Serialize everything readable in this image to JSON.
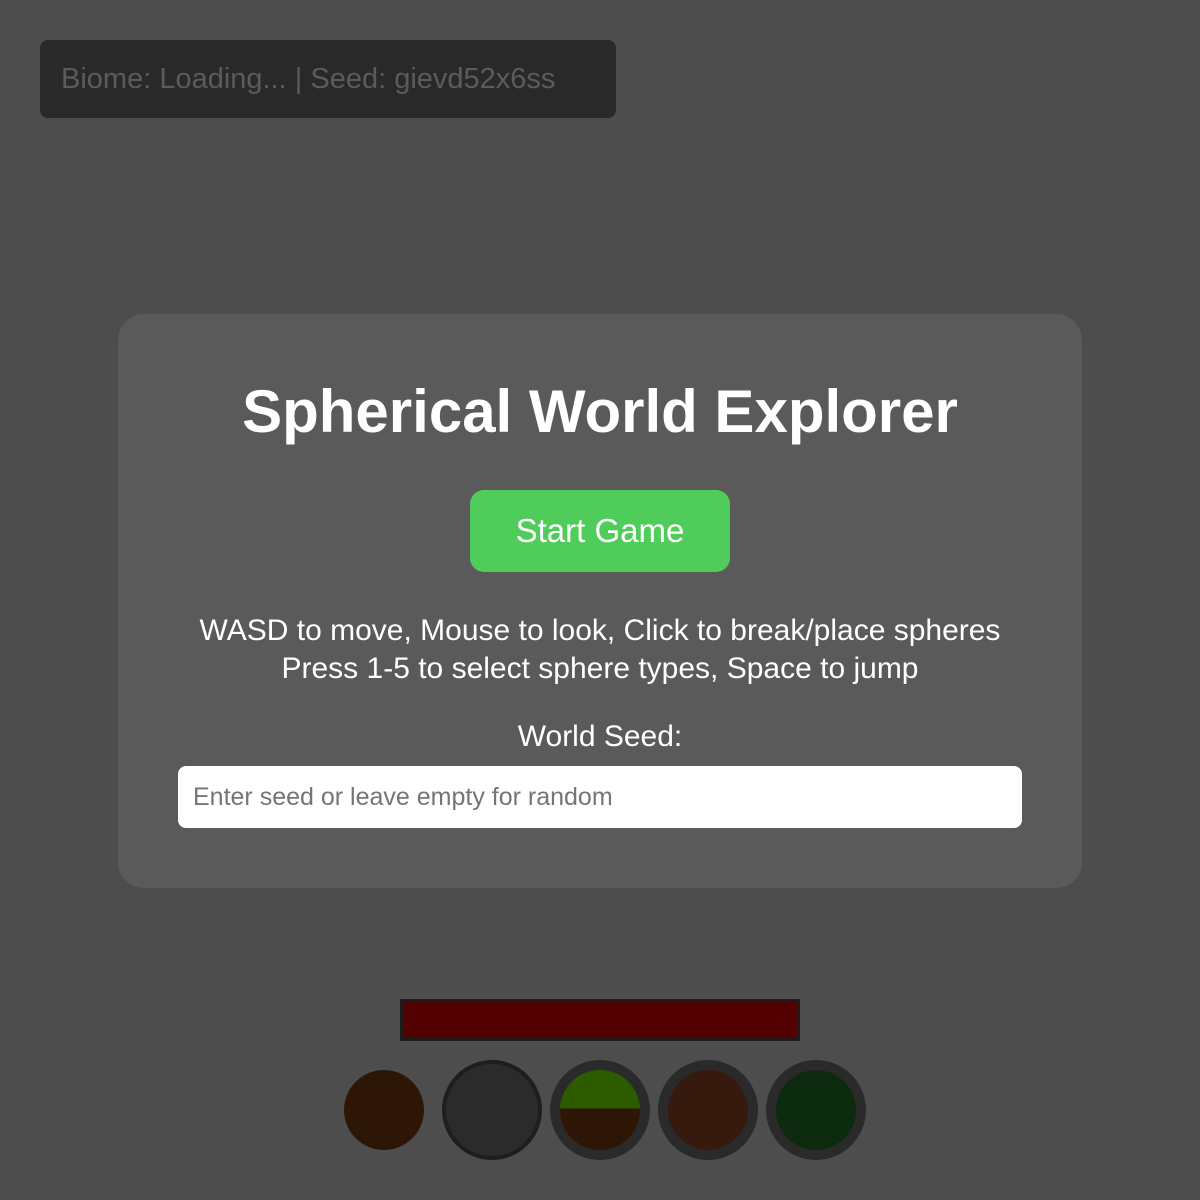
{
  "hud": {
    "info_text": "Biome: Loading... | Seed: gievd52x6ss"
  },
  "menu": {
    "title": "Spherical World Explorer",
    "start_button_label": "Start Game",
    "instructions": [
      "WASD to move, Mouse to look, Click to break/place spheres",
      "Press 1-5 to select sphere types, Space to jump"
    ],
    "seed_label": "World Seed:",
    "seed_value": "",
    "seed_placeholder": "Enter seed or leave empty for random"
  },
  "health": {
    "fraction": 1.0,
    "fill_color": "#520000"
  },
  "hotbar": {
    "selected_slot": 1,
    "slots": [
      {
        "slot": 1,
        "colors": [
          "#2d1606"
        ]
      },
      {
        "slot": 2,
        "colors": [
          "#2b2b2b"
        ]
      },
      {
        "slot": 3,
        "colors": [
          "#2d5b00",
          "#2d1606"
        ]
      },
      {
        "slot": 4,
        "colors": [
          "#361a0e"
        ]
      },
      {
        "slot": 5,
        "colors": [
          "#0c2b0e"
        ]
      }
    ]
  }
}
